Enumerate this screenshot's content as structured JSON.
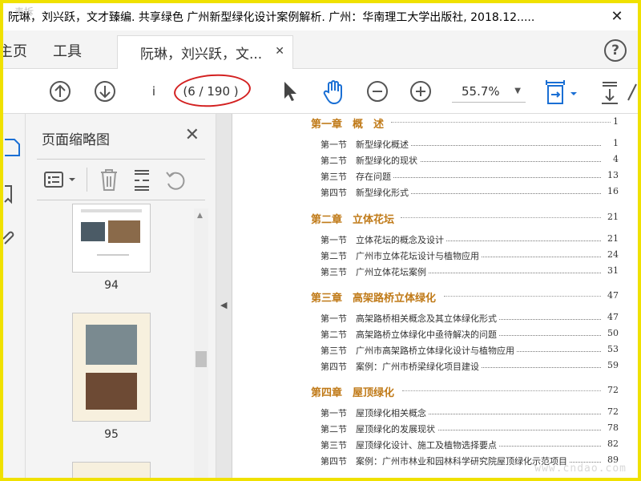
{
  "window": {
    "title": "阮琳，刘兴跃，文才臻编. 共享绿色 广州新型绿化设计案例解析. 广州：华南理工大学出版社, 2018.12.....",
    "close_glyph": "✕",
    "corner_mark": "毒拆"
  },
  "tabs": {
    "home": "主页",
    "tools": "工具",
    "document": "阮琳，刘兴跃，文...",
    "document_close": "✕",
    "help": "?"
  },
  "toolbar": {
    "page_input": "i",
    "page_count": "(6 / 190 )",
    "zoom": "55.7%"
  },
  "panel": {
    "title": "页面缩略图",
    "close": "✕",
    "thumbnails": [
      {
        "label": "94"
      },
      {
        "label": "95"
      }
    ]
  },
  "toc": {
    "chapters": [
      {
        "title": "第一章　概　述",
        "page": "1",
        "sections": [
          {
            "num": "第一节",
            "name": "新型绿化概述",
            "page": "1"
          },
          {
            "num": "第二节",
            "name": "新型绿化的现状",
            "page": "4"
          },
          {
            "num": "第三节",
            "name": "存在问题",
            "page": "13"
          },
          {
            "num": "第四节",
            "name": "新型绿化形式",
            "page": "16"
          }
        ]
      },
      {
        "title": "第二章　立体花坛",
        "page": "21",
        "sections": [
          {
            "num": "第一节",
            "name": "立体花坛的概念及设计",
            "page": "21"
          },
          {
            "num": "第二节",
            "name": "广州市立体花坛设计与植物应用",
            "page": "24"
          },
          {
            "num": "第三节",
            "name": "广州立体花坛案例",
            "page": "31"
          }
        ]
      },
      {
        "title": "第三章　高架路桥立体绿化",
        "page": "47",
        "sections": [
          {
            "num": "第一节",
            "name": "高架路桥相关概念及其立体绿化形式",
            "page": "47"
          },
          {
            "num": "第二节",
            "name": "高架路桥立体绿化中亟待解决的问题",
            "page": "50"
          },
          {
            "num": "第三节",
            "name": "广州市高架路桥立体绿化设计与植物应用",
            "page": "53"
          },
          {
            "num": "第四节",
            "name": "案例：广州市桥梁绿化项目建设",
            "page": "59"
          }
        ]
      },
      {
        "title": "第四章　屋顶绿化",
        "page": "72",
        "sections": [
          {
            "num": "第一节",
            "name": "屋顶绿化相关概念",
            "page": "72"
          },
          {
            "num": "第二节",
            "name": "屋顶绿化的发展现状",
            "page": "78"
          },
          {
            "num": "第三节",
            "name": "屋顶绿化设计、施工及植物选择要点",
            "page": "82"
          },
          {
            "num": "第四节",
            "name": "案例：广州市林业和园林科学研究院屋顶绿化示范项目",
            "page": "89"
          }
        ]
      }
    ]
  },
  "watermark": "www.cndao.com",
  "colors": {
    "border": "#f0e100",
    "chapter": "#c07a18",
    "annotation": "#d32020",
    "tool_active": "#1a6fd4"
  }
}
